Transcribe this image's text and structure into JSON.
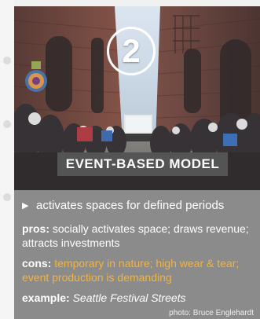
{
  "title": "EVENT-BASED MODEL",
  "number_label": "2",
  "bullet_text": "activates spaces for defined periods",
  "pros": {
    "label": "pros:",
    "text": "socially activates space; draws revenue; attracts investments"
  },
  "cons": {
    "label": "cons:",
    "text": "temporary in nature; high wear & tear; event production is demanding"
  },
  "example": {
    "label": "example:",
    "text": "Seattle Festival Streets"
  },
  "photo_credit": "photo: Bruce Englehardt",
  "colors": {
    "accent": "#f4b33c",
    "card": "#8b8b8b",
    "page": "#f1f1f1",
    "white": "#ffffff"
  },
  "icons": {
    "number": "number-badge-icon",
    "bullet": "play-triangle-icon",
    "photo": "festival-street-photo"
  }
}
